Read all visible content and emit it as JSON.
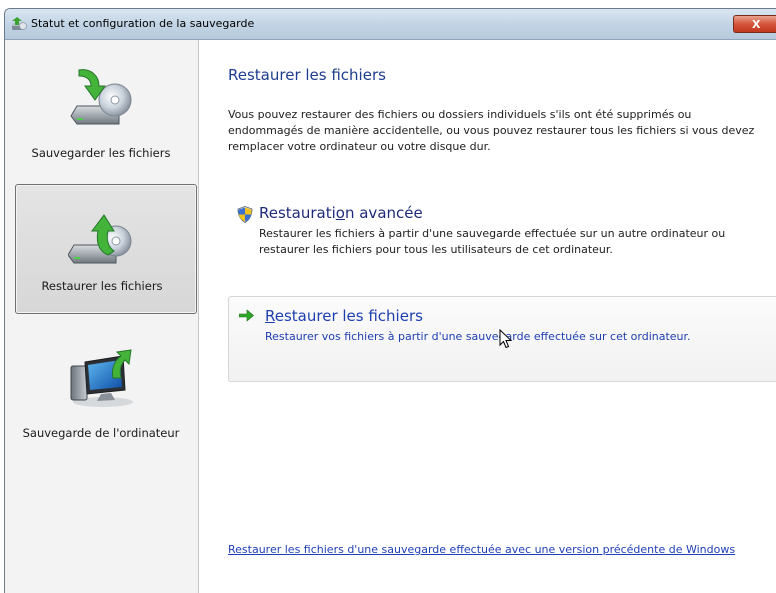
{
  "window": {
    "title": "Statut et configuration de la sauvegarde",
    "close_label": "X"
  },
  "sidebar": {
    "items": [
      {
        "label": "Sauvegarder les fichiers",
        "icon": "backup-files-icon",
        "selected": false
      },
      {
        "label": "Restaurer les fichiers",
        "icon": "restore-files-icon",
        "selected": true
      },
      {
        "label": "Sauvegarde de l'ordinateur",
        "icon": "computer-backup-icon",
        "selected": false
      }
    ]
  },
  "main": {
    "title": "Restaurer les fichiers",
    "description": "Vous pouvez restaurer des fichiers ou dossiers individuels s'ils ont été supprimés ou endommagés de manière accidentelle, ou vous pouvez restaurer tous les fichiers si vous devez remplacer votre ordinateur ou votre disque dur.",
    "advanced_option": {
      "title_before": "Restaurati",
      "title_accel": "o",
      "title_after": "n avancée",
      "description": "Restaurer les fichiers à partir d'une sauvegarde effectuée sur un autre ordinateur ou restaurer les fichiers pour tous les utilisateurs de cet ordinateur.",
      "icon": "uac-shield-icon"
    },
    "restore_option": {
      "title_accel": "R",
      "title_after": "estaurer les fichiers",
      "description": "Restaurer vos fichiers à partir d'une sauvegarde effectuée sur cet ordinateur.",
      "icon": "green-arrow-icon"
    },
    "previous_version_link": "Restaurer les fichiers d'une sauvegarde effectuée avec une version précédente de Windows"
  },
  "colors": {
    "title_blue": "#1e3d8f",
    "link_blue": "#1f3fb8",
    "selected_bg": "#d7d7d7",
    "close_red": "#d4543b"
  }
}
